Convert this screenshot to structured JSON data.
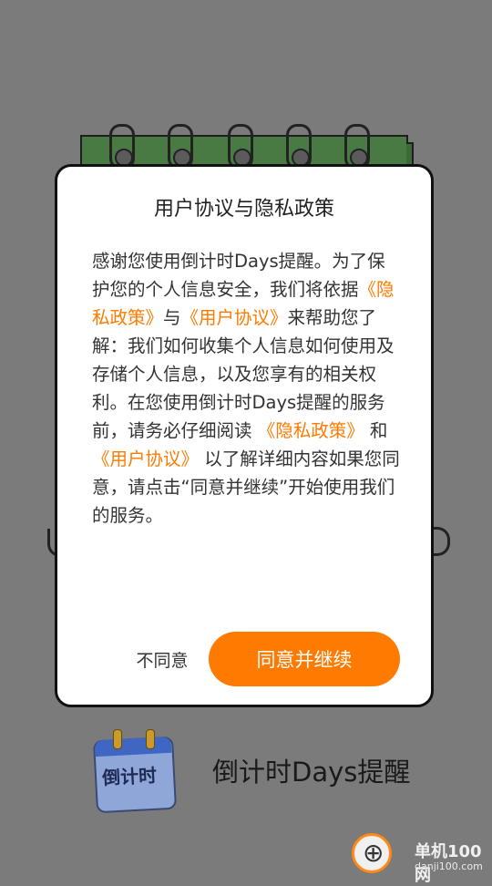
{
  "dialog": {
    "title": "用户协议与隐私政策",
    "body": {
      "p1": "感谢您使用倒计时Days提醒。为了保护您的个人信息安全，我们将依据",
      "link_privacy": "《隐私政策》",
      "and1": "与",
      "link_user": "《用户协议》",
      "p2": "来帮助您了解：我们如何收集个人信息如何使用及存储个人信息，以及您享有的相关权利。在您使用倒计时Days提醒的服务前，请务必仔细阅读 ",
      "link_privacy2": "《隐私政策》",
      "and2": " 和 ",
      "link_user2": "《用户协议》",
      "p3": " 以了解详细内容如果您同意，请点击“同意并继续”开始使用我们的服务。"
    },
    "disagree_label": "不同意",
    "agree_label": "同意并继续"
  },
  "app": {
    "icon_text": "倒计时",
    "name": "倒计时Days提醒"
  },
  "watermark": {
    "brand": "单机100网",
    "url": "danji100.com"
  },
  "colors": {
    "accent": "#ff7a00",
    "overlay": "#7b7b7b"
  }
}
